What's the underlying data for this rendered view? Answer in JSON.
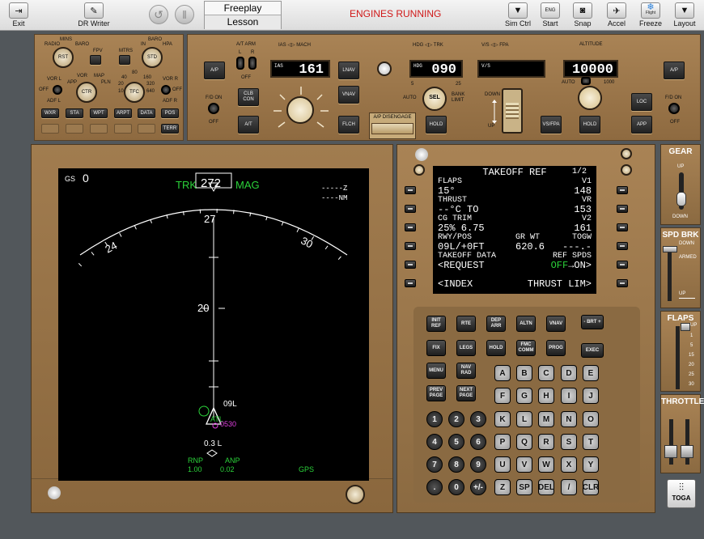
{
  "toolbar": {
    "exit": "Exit",
    "dr_writer": "DR Writer",
    "mode_tabs": [
      "Freeplay",
      "Lesson"
    ],
    "status": "ENGINES RUNNING",
    "right_buttons": [
      "Sim Ctrl",
      "Start",
      "Snap",
      "Accel",
      "Freeze",
      "Layout"
    ],
    "start_icon_text": "ENG",
    "freeze_icon_text": "Flight"
  },
  "efis": {
    "labels": [
      "RADIO",
      "MINS",
      "BARO",
      "FPV",
      "MTRS",
      "IN",
      "BARO",
      "HPA",
      "VOR L",
      "OFF",
      "ADF L",
      "APP",
      "VOR",
      "MAP",
      "PLN",
      "40",
      "80",
      "160",
      "20",
      "320",
      "10",
      "640",
      "VOR R",
      "OFF",
      "ADF R"
    ],
    "knobs": [
      "RST",
      "CTR",
      "TFC",
      "STD"
    ],
    "buttons": [
      "WXR",
      "STA",
      "WPT",
      "ARPT",
      "DATA",
      "POS",
      "TERR"
    ]
  },
  "mcp": {
    "at_arm": "A/T ARM",
    "at_l": "L",
    "at_r": "R",
    "at_off": "OFF",
    "fd_on": "F/D ON",
    "fd_off": "OFF",
    "ias_mach": "IAS ◁▷ MACH",
    "ias_label": "IAS",
    "ias_value": "161",
    "hdg_trk": "HDG ◁▷ TRK",
    "hdg_label": "HDG",
    "hdg_value": "090",
    "vs_fpa": "V/S ◁▷ FPA",
    "vs_label": "V/S",
    "altitude": "ALTITUDE",
    "alt_value": "10000",
    "auto": "AUTO",
    "alt_1000": "1000",
    "bank_5": "5",
    "bank_25": "25",
    "bank_auto": "AUTO",
    "bank_limit": "BANK LIMIT",
    "sel": "SEL",
    "down": "DOWN",
    "up": "UP",
    "ap_disengage": "A/P DISENGAGE",
    "buttons": {
      "ap_left": "A/P",
      "clb_con": "CLB CON",
      "at": "A/T",
      "lnav": "LNAV",
      "vnav": "VNAV",
      "flch": "FLCH",
      "hdg_hold": "HOLD",
      "vs_fpa_btn": "VS/FPA",
      "alt_hold": "HOLD",
      "ap_right": "A/P",
      "loc": "LOC",
      "app": "APP"
    }
  },
  "nd": {
    "gs_label": "GS",
    "gs_value": "0",
    "trk": "TRK",
    "heading": "272",
    "mag": "MAG",
    "z_label": "-----Z",
    "nm_label": "----NM",
    "compass": [
      "27",
      "24",
      "30"
    ],
    "range_label": "20",
    "runway": "09L",
    "waypoint_1": "ATL",
    "waypoint_2": "0530",
    "offset": "0.3 L",
    "rnp_label": "RNP",
    "rnp_value": "1.00",
    "anp_label": "ANP",
    "anp_value": "0.02",
    "gps": "GPS"
  },
  "cdu": {
    "title": "TAKEOFF REF",
    "page": "1/2",
    "lines": {
      "flaps_label": "FLAPS",
      "v1_label": "V1",
      "flaps_value": "15°",
      "v1_value": "148",
      "thrust_label": "THRUST",
      "vr_label": "VR",
      "thrust_value": "--°C TO",
      "vr_value": "153",
      "cg_label": "CG TRIM",
      "v2_label": "V2",
      "cg_value": "25% 6.75",
      "v2_value": "161",
      "rwy_label": "RWY/POS",
      "grwt_label": "GR WT",
      "togw_label": "TOGW",
      "rwy_value": "09L/+0FT",
      "grwt_value": "620.6",
      "togw_value": "---.-",
      "to_data_label": "TAKEOFF DATA",
      "ref_spds_label": "REF SPDS",
      "request": "<REQUEST",
      "off": "OFF",
      "on": "→ON>",
      "index": "<INDEX",
      "thrust_lim": "THRUST LIM>"
    },
    "func_keys": [
      "INIT REF",
      "RTE",
      "DEP ARR",
      "ALTN",
      "VNAV",
      "FIX",
      "LEGS",
      "HOLD",
      "FMC COMM",
      "PROG",
      "MENU",
      "NAV RAD",
      "PREV PAGE",
      "NEXT PAGE"
    ],
    "brt": "- BRT +",
    "exec": "EXEC",
    "alpha": [
      "A",
      "B",
      "C",
      "D",
      "E",
      "F",
      "G",
      "H",
      "I",
      "J",
      "K",
      "L",
      "M",
      "N",
      "O",
      "P",
      "Q",
      "R",
      "S",
      "T",
      "U",
      "V",
      "W",
      "X",
      "Y",
      "Z",
      "SP",
      "DEL",
      "/",
      "CLR"
    ],
    "numeric": [
      "1",
      "2",
      "3",
      "4",
      "5",
      "6",
      "7",
      "8",
      "9",
      ".",
      "0",
      "+/-"
    ]
  },
  "right": {
    "gear_title": "GEAR",
    "gear_up": "UP",
    "gear_down": "DOWN",
    "spd_title": "SPD BRK",
    "spd_down": "DOWN",
    "spd_armed": "ARMED",
    "spd_up": "UP",
    "flaps_title": "FLAPS",
    "flaps_marks": [
      "UP",
      "1",
      "5",
      "15",
      "20",
      "25",
      "30"
    ],
    "throttles_title": "THROTTLES",
    "toga": "TOGA"
  }
}
